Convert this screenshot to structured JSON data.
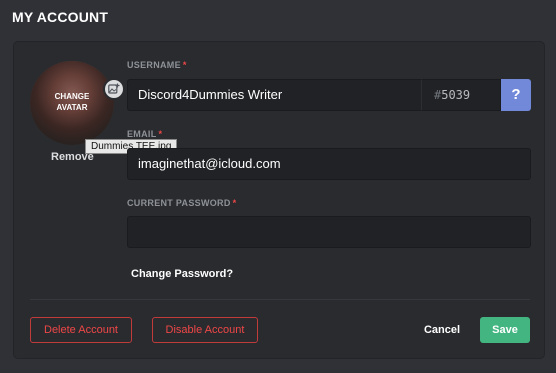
{
  "page": {
    "title": "MY ACCOUNT"
  },
  "avatar": {
    "overlay_text": "CHANGE AVATAR",
    "upload_icon": "image-add-icon",
    "remove_label": "Remove",
    "tooltip": "Dummies TEE.jpg"
  },
  "fields": {
    "username": {
      "label": "USERNAME",
      "required_mark": "*",
      "value": "Discord4Dummies Writer"
    },
    "discriminator": {
      "hash": "#",
      "value": "5039"
    },
    "help": {
      "label": "?",
      "icon": "help-icon"
    },
    "email": {
      "label": "EMAIL",
      "required_mark": "*",
      "value": "imaginethat@icloud.com"
    },
    "current_password": {
      "label": "CURRENT PASSWORD",
      "required_mark": "*",
      "value": ""
    }
  },
  "links": {
    "change_password": "Change Password?"
  },
  "actions": {
    "delete_account": "Delete Account",
    "disable_account": "Disable Account",
    "cancel": "Cancel",
    "save": "Save"
  },
  "colors": {
    "accent": "#7289da",
    "save": "#43b581",
    "danger": "#f04747",
    "background": "#2f3136",
    "card": "#292b2f",
    "input": "#202225"
  }
}
